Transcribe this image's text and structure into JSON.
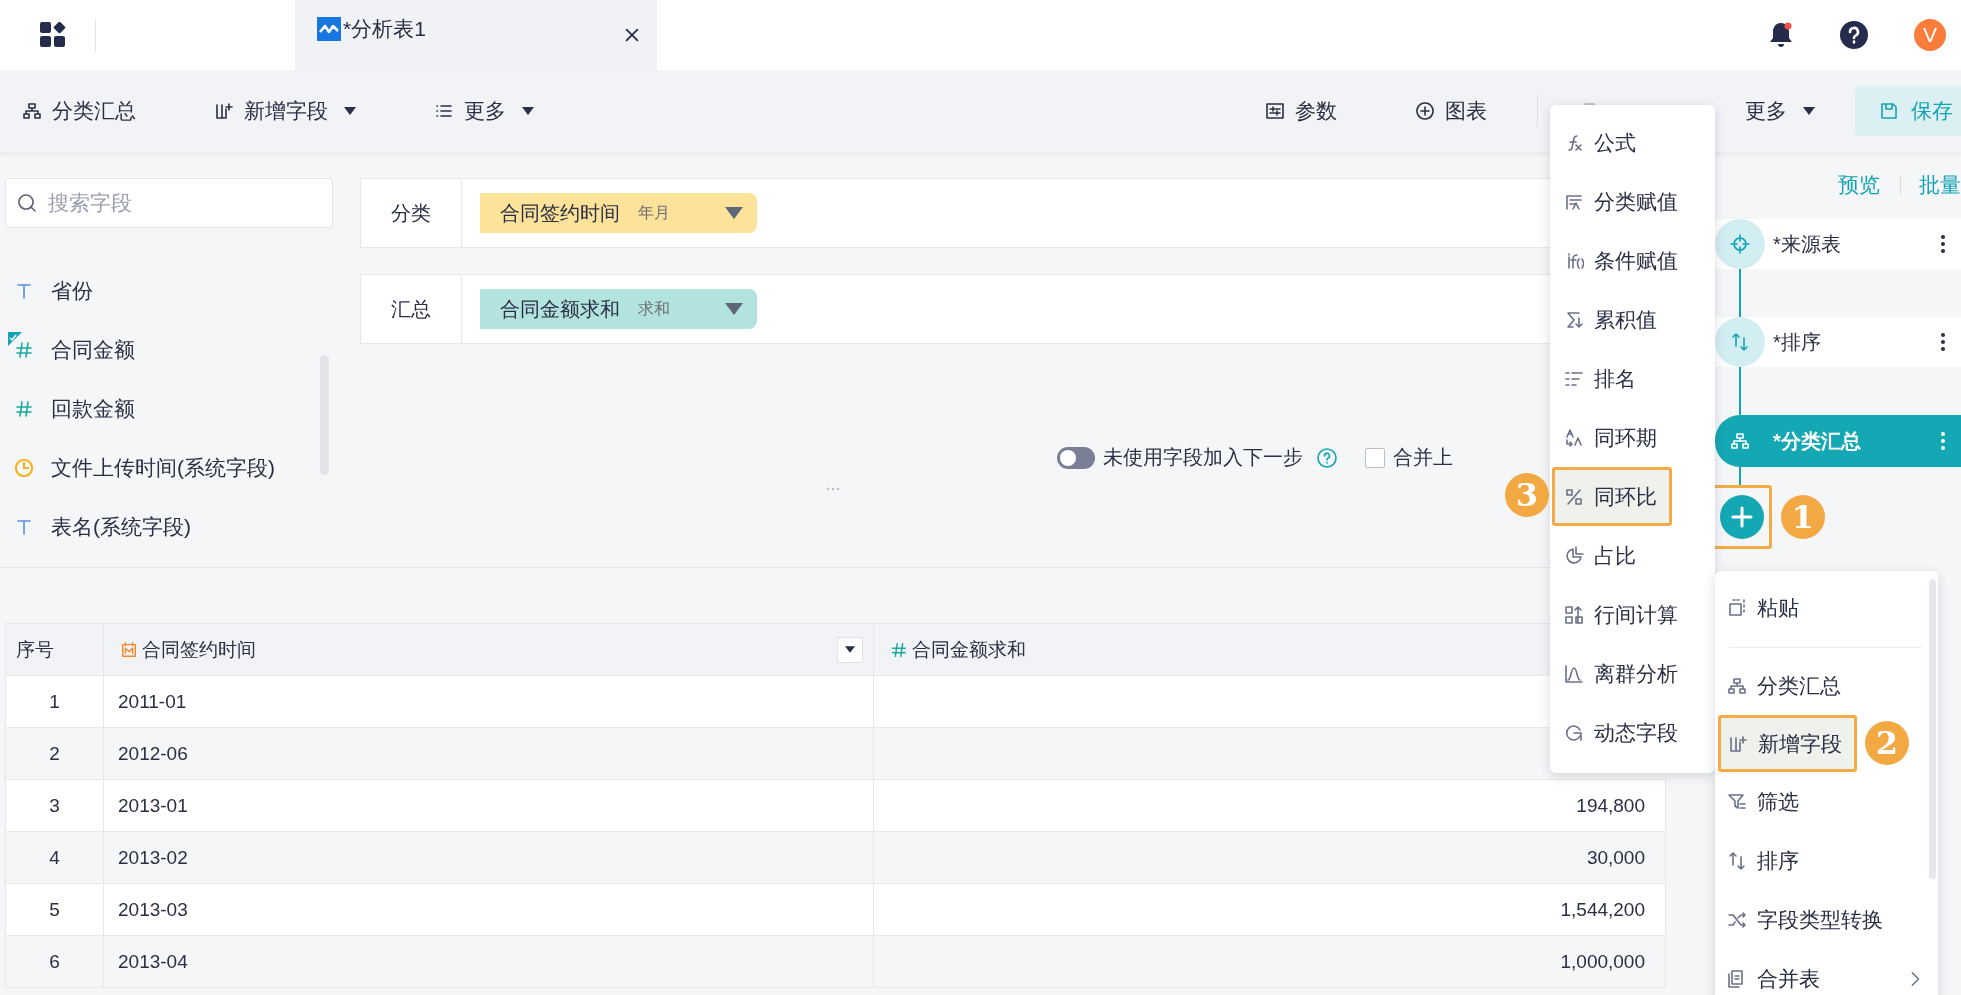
{
  "app_bar": {
    "tab": {
      "title": "*分析表1",
      "selected": true
    },
    "notification": true,
    "avatar": "V"
  },
  "toolbar": {
    "left": [
      {
        "label": "分类汇总",
        "dropdown": false
      },
      {
        "label": "新增字段",
        "dropdown": true
      },
      {
        "label": "更多",
        "dropdown": true
      }
    ],
    "right": [
      {
        "label": "参数"
      },
      {
        "label": "图表"
      }
    ],
    "more": {
      "label": "更多",
      "dropdown": true
    },
    "save": "保存"
  },
  "search": {
    "placeholder": "搜索字段"
  },
  "fields": [
    {
      "kind": "text",
      "name": "省份",
      "in_use": false
    },
    {
      "kind": "number",
      "name": "合同金额",
      "in_use": true
    },
    {
      "kind": "number",
      "name": "回款金额",
      "in_use": false
    },
    {
      "kind": "time",
      "name": "文件上传时间(系统字段)",
      "in_use": false
    },
    {
      "kind": "text",
      "name": "表名(系统字段)",
      "in_use": false
    }
  ],
  "shelves": [
    {
      "label": "分类",
      "chip": "合同签约时间",
      "aggregation": "年月",
      "color": "#fde39a"
    },
    {
      "label": "汇总",
      "chip": "合同金额求和",
      "aggregation": "求和",
      "color": "#b2e3de"
    }
  ],
  "options": {
    "toggle": {
      "label": "未使用字段加入下一步",
      "on": false
    },
    "checkbox": {
      "label": "合并上",
      "checked": false
    }
  },
  "table": {
    "columns": [
      {
        "kind": "index",
        "label": "序号"
      },
      {
        "kind": "date",
        "label": "合同签约时间",
        "filter": true
      },
      {
        "kind": "number",
        "label": "合同金额求和"
      }
    ],
    "rows": [
      [
        "1",
        "2011-01"
      ],
      [
        "2",
        "2012-06"
      ],
      [
        "3",
        "2013-01",
        "194,800"
      ],
      [
        "4",
        "2013-02",
        "30,000"
      ],
      [
        "5",
        "2013-03",
        "1,544,200"
      ],
      [
        "6",
        "2013-04",
        "1,000,000"
      ]
    ]
  },
  "flow": {
    "links": [
      "预览",
      "批量"
    ],
    "nodes": [
      {
        "kind": "source",
        "label": "*来源表",
        "selected": false
      },
      {
        "kind": "sort",
        "label": "*排序",
        "selected": false
      },
      {
        "kind": "summary",
        "label": "*分类汇总",
        "selected": true
      }
    ],
    "add_button": {
      "highlighted": true,
      "badge": "1"
    }
  },
  "calc_menu": [
    {
      "label": "公式",
      "selected": false
    },
    {
      "label": "分类赋值",
      "selected": false
    },
    {
      "label": "条件赋值",
      "selected": false
    },
    {
      "label": "累积值",
      "selected": false
    },
    {
      "label": "排名",
      "selected": false
    },
    {
      "label": "同环期",
      "selected": false
    },
    {
      "label": "同环比",
      "selected": true,
      "badge": "3"
    },
    {
      "label": "占比",
      "selected": false
    },
    {
      "label": "行间计算",
      "selected": false
    },
    {
      "label": "离群分析",
      "selected": false
    },
    {
      "label": "动态字段",
      "selected": false
    }
  ],
  "step_menu": [
    {
      "label": "粘贴",
      "selected": false,
      "divider_after": true
    },
    {
      "label": "分类汇总",
      "selected": false
    },
    {
      "label": "新增字段",
      "selected": true,
      "badge": "2"
    },
    {
      "label": "筛选",
      "selected": false
    },
    {
      "label": "排序",
      "selected": false
    },
    {
      "label": "字段类型转换",
      "selected": false
    },
    {
      "label": "合并表",
      "selected": false,
      "submenu": true
    }
  ]
}
